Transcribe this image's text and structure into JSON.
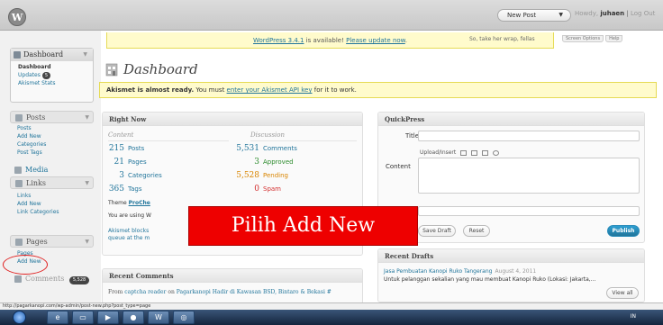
{
  "topbar": {
    "logo": "W",
    "new_post": "New Post",
    "howdy_prefix": "Howdy,",
    "username": "juhaen",
    "separator": "|",
    "logout": "Log Out"
  },
  "notice": {
    "update_link": "WordPress 3.4.1",
    "update_text": " is available! ",
    "update_cta": "Please update now",
    "update_end": ".",
    "tagline": "So, take her wrap, fellas",
    "screen_options": "Screen Options",
    "help": "Help"
  },
  "page_title": "Dashboard",
  "akismet_notice": {
    "strong": "Akismet is almost ready.",
    "text": " You must ",
    "link": "enter your Akismet API key",
    "end": " for it to work."
  },
  "sidebar": {
    "dashboard": "Dashboard",
    "dashboard_items": [
      "Dashboard",
      "Updates",
      "Akismet Stats"
    ],
    "updates_badge": "5",
    "posts": "Posts",
    "posts_items": [
      "Posts",
      "Add New",
      "Categories",
      "Post Tags"
    ],
    "media": "Media",
    "links": "Links",
    "links_items": [
      "Links",
      "Add New",
      "Link Categories"
    ],
    "pages": "Pages",
    "pages_items": [
      "Pages",
      "Add New"
    ],
    "comments": "Comments",
    "comments_badge": "5,528"
  },
  "right_now": {
    "title": "Right Now",
    "content_label": "Content",
    "discussion_label": "Discussion",
    "content": [
      {
        "num": "215",
        "label": "Posts"
      },
      {
        "num": "21",
        "label": "Pages"
      },
      {
        "num": "3",
        "label": "Categories"
      },
      {
        "num": "365",
        "label": "Tags"
      }
    ],
    "discussion": [
      {
        "num": "5,531",
        "label": "Comments"
      },
      {
        "num": "3",
        "label": "Approved"
      },
      {
        "num": "5,528",
        "label": "Pending"
      },
      {
        "num": "0",
        "label": "Spam"
      }
    ],
    "theme_prefix": "Theme",
    "theme_name": "ProChe",
    "using": "You are using W",
    "akismet_1": "Akismet blocks",
    "akismet_2": "queue at the m"
  },
  "annotation": "Pilih Add New",
  "quickpress": {
    "title": "QuickPress",
    "title_label": "Title",
    "upload_label": "Upload/Insert",
    "content_label": "Content",
    "save_draft": "Save Draft",
    "reset": "Reset",
    "publish": "Publish"
  },
  "recent_drafts": {
    "title": "Recent Drafts",
    "draft_title": "Jasa Pembuatan Kanopi Ruko Tangerang",
    "draft_date": "August 4, 2011",
    "draft_excerpt": "Untuk pelanggan sekalian yang mau membuat Kanopi Ruko (Lokasi: Jakarta,...",
    "view_all": "View all"
  },
  "recent_comments": {
    "title": "Recent Comments",
    "from": "From",
    "author": "captcha reader",
    "on": "on",
    "post": "Pagarkanopi Hadir di Kawasan BSD, Bintaro & Bekasi #"
  },
  "statusbar": "http://pagarkanopi.com/wp-admin/post-new.php?post_type=page",
  "tray": "IN"
}
